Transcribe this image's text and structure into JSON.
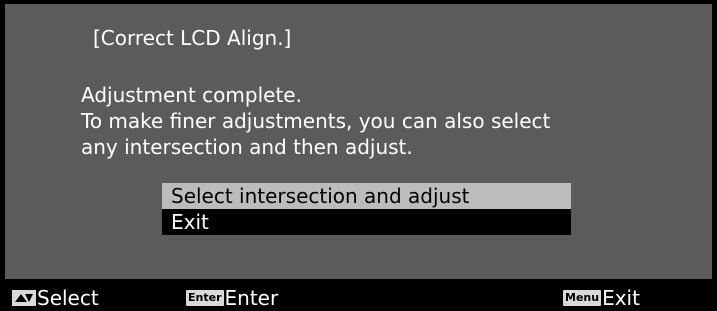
{
  "dialog": {
    "title": "[Correct LCD Align.]",
    "message_lines": [
      "Adjustment complete.",
      "To make finer adjustments, you can also select",
      "any intersection and then adjust."
    ],
    "options": [
      {
        "label": "Select intersection and adjust",
        "selected": true
      },
      {
        "label": "Exit",
        "selected": false
      }
    ]
  },
  "footer": {
    "select": {
      "key_icon": "up-down-arrows-icon",
      "label": "Select"
    },
    "enter": {
      "key": "Enter",
      "label": "Enter"
    },
    "exit": {
      "key": "Menu",
      "label": "Exit"
    }
  },
  "colors": {
    "panel_bg": "#5b5b5b",
    "frame_bg": "#000000",
    "selected_bg": "#bcbcbc",
    "text": "#ffffff"
  }
}
